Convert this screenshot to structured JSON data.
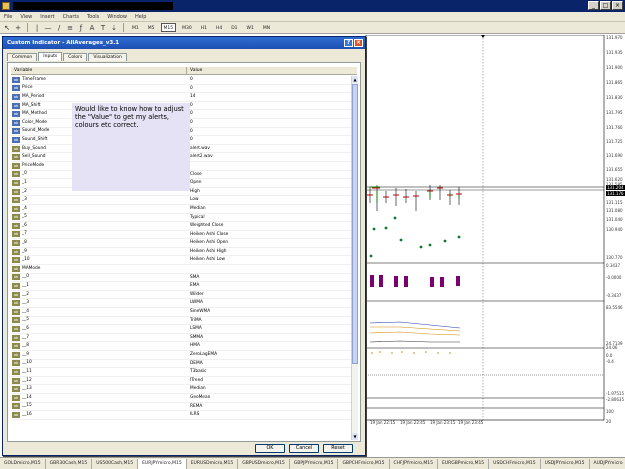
{
  "menu": [
    "File",
    "View",
    "Insert",
    "Charts",
    "Tools",
    "Window",
    "Help"
  ],
  "timeframes": [
    "M1",
    "M5",
    "M15",
    "M30",
    "H1",
    "H4",
    "D1",
    "W1",
    "MN"
  ],
  "active_timeframe": "M15",
  "dialog": {
    "title": "Custom Indicator - AllAverages_v3.1",
    "tabs": [
      "Common",
      "Inputs",
      "Colors",
      "Visualization"
    ],
    "active_tab": "Inputs",
    "col_variable": "Variable",
    "col_value": "Value",
    "note": "Would like to know how to adjust the \"Value\" to get my alerts, colours etc correct.",
    "buttons": {
      "ok": "OK",
      "cancel": "Cancel",
      "reset": "Reset"
    },
    "rows": [
      {
        "name": "TimeFrame",
        "value": "0"
      },
      {
        "name": "Price",
        "value": "0"
      },
      {
        "name": "MA_Period",
        "value": "14"
      },
      {
        "name": "MA_Shift",
        "value": "0"
      },
      {
        "name": "MA_Method",
        "value": "0"
      },
      {
        "name": "Color_Mode",
        "value": "0"
      },
      {
        "name": "Sound_Mode",
        "value": "0"
      },
      {
        "name": "Sound_Shift",
        "value": "0"
      },
      {
        "name": "Buy_Sound",
        "value": "alert.wav"
      },
      {
        "name": "Sell_Sound",
        "value": "alert2.wav"
      },
      {
        "name": "PriceMode",
        "value": ""
      },
      {
        "name": "_0",
        "value": "Close"
      },
      {
        "name": "_1",
        "value": "Open"
      },
      {
        "name": "_2",
        "value": "High"
      },
      {
        "name": "_3",
        "value": "Low"
      },
      {
        "name": "_4",
        "value": "Median"
      },
      {
        "name": "_5",
        "value": "Typical"
      },
      {
        "name": "_6",
        "value": "Weighted Close"
      },
      {
        "name": "_7",
        "value": "Heiken Ashi Close"
      },
      {
        "name": "_8",
        "value": "Heiken Ashi Open"
      },
      {
        "name": "_9",
        "value": "Heiken Ashi High"
      },
      {
        "name": "_10",
        "value": "Heiken Ashi Low"
      },
      {
        "name": "MAMode",
        "value": ""
      },
      {
        "name": "__0",
        "value": "SMA"
      },
      {
        "name": "__1",
        "value": "EMA"
      },
      {
        "name": "__2",
        "value": "Wilder"
      },
      {
        "name": "__3",
        "value": "LWMA"
      },
      {
        "name": "__4",
        "value": "SineWMA"
      },
      {
        "name": "__5",
        "value": "TriMA"
      },
      {
        "name": "__6",
        "value": "LSMA"
      },
      {
        "name": "__7",
        "value": "SMMA"
      },
      {
        "name": "__8",
        "value": "HMA"
      },
      {
        "name": "__9",
        "value": "ZeroLagEMA"
      },
      {
        "name": "__10",
        "value": "DEMA"
      },
      {
        "name": "__11",
        "value": "T3basic"
      },
      {
        "name": "__12",
        "value": "ITrend"
      },
      {
        "name": "__13",
        "value": "Median"
      },
      {
        "name": "__14",
        "value": "GeoMean"
      },
      {
        "name": "__15",
        "value": "REMA"
      },
      {
        "name": "__16",
        "value": "ILRS"
      }
    ]
  },
  "price_axis": [
    {
      "label": "131.970"
    },
    {
      "label": "131.935"
    },
    {
      "label": "131.900"
    },
    {
      "label": "131.865"
    },
    {
      "label": "131.830"
    },
    {
      "label": "131.795"
    },
    {
      "label": "131.760"
    },
    {
      "label": "131.725"
    },
    {
      "label": "131.690"
    },
    {
      "label": "131.655"
    },
    {
      "label": "131.620"
    },
    {
      "label": "131.585"
    },
    {
      "label": "131.550"
    },
    {
      "label": "131.204",
      "highlight": true
    },
    {
      "label": "131.176",
      "highlight": true
    },
    {
      "label": "131.115"
    },
    {
      "label": "131.080"
    },
    {
      "label": "131.040"
    },
    {
      "label": "130.940"
    },
    {
      "label": "130.770"
    }
  ],
  "sub_axis": [
    "0.3437",
    "-0.0000",
    "-0.3437",
    "83.5546",
    "24.7139",
    "24.06",
    "0.0",
    "-0.4",
    "-1.97515",
    "-2.80635",
    "100",
    "20"
  ],
  "time_labels": [
    "19 Jan 22:15",
    "19 Jan 22:45",
    "19 Jan 23:15",
    "19 Jan 23:45"
  ],
  "bottom_tabs": [
    "GOLDmicro,M15",
    "GBR30Cash,M15",
    "US500Cash,M15",
    "EURJPYmicro,M15",
    "EURUSDmicro,M15",
    "GBPUSDmicro,M15",
    "GBPJPYmicro,M15",
    "GBPCHFmicro,M15",
    "CHFJPYmicro,M15",
    "EURGBPmicro,M15",
    "USDCHFmicro,M15",
    "USDJPYmicro,M15",
    "AUDJPYmicro"
  ],
  "active_bottom_tab": "EURJPYmicro,M15",
  "colors": {
    "dialog_title": "#1d4fb3",
    "note_bg": "#e4e2f4",
    "histogram": "#7a0070"
  }
}
